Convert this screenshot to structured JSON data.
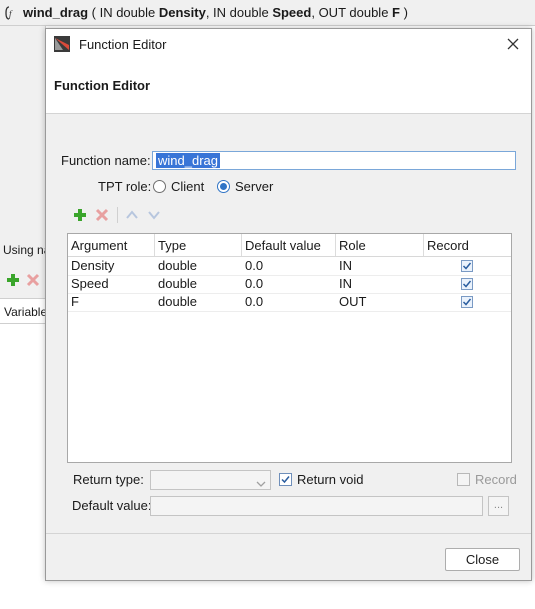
{
  "background_window": {
    "signature": {
      "name": "wind_drag",
      "open": " ( ",
      "p1_mode": "IN double ",
      "p1_name": "Density",
      "sep1": ", ",
      "p2_mode": "IN double ",
      "p2_name": "Speed",
      "sep2": ", ",
      "p3_mode": "OUT double ",
      "p3_name": "F",
      "close": " )"
    },
    "using_label": "Using na",
    "variables_header": "Variable"
  },
  "dialog": {
    "window_title": "Function Editor",
    "header_title": "Function Editor",
    "function_name_label": "Function name:",
    "function_name_value": "wind_drag",
    "tpt_role_label": "TPT role:",
    "role_options": [
      {
        "label": "Client",
        "selected": false
      },
      {
        "label": "Server",
        "selected": true
      }
    ],
    "toolbar_icons": [
      "add-icon",
      "delete-icon",
      "move-up-icon",
      "move-down-icon"
    ],
    "table": {
      "columns": [
        "Argument",
        "Type",
        "Default value",
        "Role",
        "Record"
      ],
      "rows": [
        {
          "argument": "Density",
          "type": "double",
          "default_value": "0.0",
          "role": "IN",
          "record": true
        },
        {
          "argument": "Speed",
          "type": "double",
          "default_value": "0.0",
          "role": "IN",
          "record": true
        },
        {
          "argument": "F",
          "type": "double",
          "default_value": "0.0",
          "role": "OUT",
          "record": true
        }
      ]
    },
    "return_type_label": "Return type:",
    "return_type_value": "",
    "return_void_label": "Return void",
    "return_void_checked": true,
    "record_label": "Record",
    "record_checked": false,
    "default_value_label": "Default value:",
    "default_value_value": "",
    "browse_button_label": "...",
    "close_button_label": "Close"
  },
  "colors": {
    "accent": "#2f74c6",
    "selection": "#3875d7",
    "add_green": "#3aa52b",
    "delete_red": "#d9534f"
  }
}
